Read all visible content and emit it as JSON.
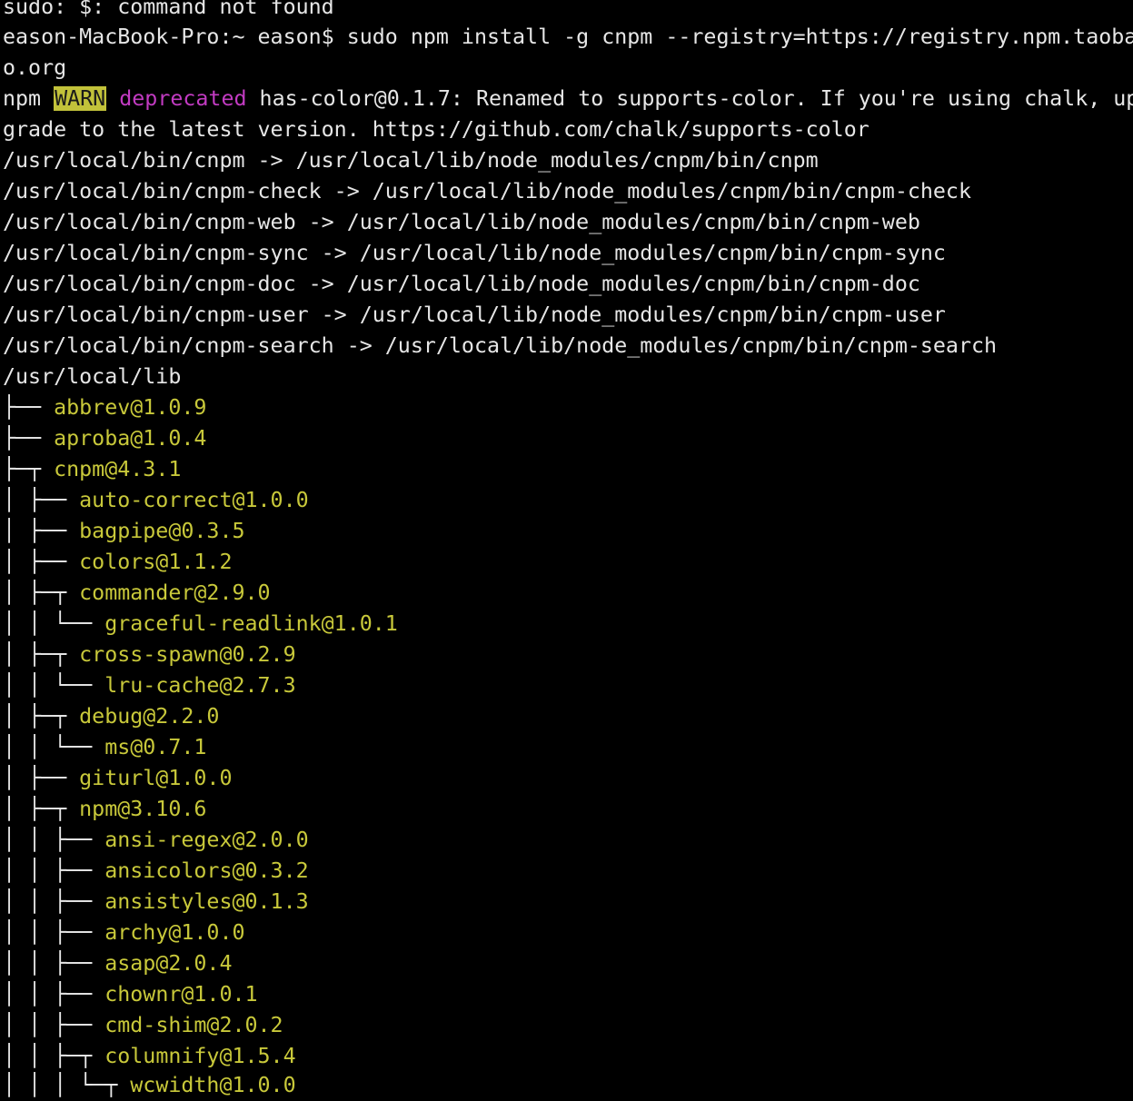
{
  "colors": {
    "background": "#000000",
    "text": "#e6e6e6",
    "package": "#c8c83a",
    "warn_bg": "#c2c23a",
    "deprecated": "#c23bc2"
  },
  "lines": {
    "l0": "sudo: $: command not found",
    "l1": "eason-MacBook-Pro:~ eason$ sudo npm install -g cnpm --registry=https://registry.npm.taoba",
    "l2": "o.org",
    "l3": {
      "prefix": "npm ",
      "warn": "WARN",
      "deprecated": "deprecated",
      "message": " has-color@0.1.7: Renamed to supports-color. If you're using chalk, up"
    },
    "l4": "grade to the latest version. https://github.com/chalk/supports-color",
    "l5": "/usr/local/bin/cnpm -> /usr/local/lib/node_modules/cnpm/bin/cnpm",
    "l6": "/usr/local/bin/cnpm-check -> /usr/local/lib/node_modules/cnpm/bin/cnpm-check",
    "l7": "/usr/local/bin/cnpm-web -> /usr/local/lib/node_modules/cnpm/bin/cnpm-web",
    "l8": "/usr/local/bin/cnpm-sync -> /usr/local/lib/node_modules/cnpm/bin/cnpm-sync",
    "l9": "/usr/local/bin/cnpm-doc -> /usr/local/lib/node_modules/cnpm/bin/cnpm-doc",
    "l10": "/usr/local/bin/cnpm-user -> /usr/local/lib/node_modules/cnpm/bin/cnpm-user",
    "l11": "/usr/local/bin/cnpm-search -> /usr/local/lib/node_modules/cnpm/bin/cnpm-search",
    "l12": "/usr/local/lib"
  },
  "tree": [
    {
      "glyphs": "├── ",
      "pkg": "abbrev@1.0.9"
    },
    {
      "glyphs": "├── ",
      "pkg": "aproba@1.0.4"
    },
    {
      "glyphs": "├─┬ ",
      "pkg": "cnpm@4.3.1"
    },
    {
      "glyphs": "│ ├── ",
      "pkg": "auto-correct@1.0.0"
    },
    {
      "glyphs": "│ ├── ",
      "pkg": "bagpipe@0.3.5"
    },
    {
      "glyphs": "│ ├── ",
      "pkg": "colors@1.1.2"
    },
    {
      "glyphs": "│ ├─┬ ",
      "pkg": "commander@2.9.0"
    },
    {
      "glyphs": "│ │ └── ",
      "pkg": "graceful-readlink@1.0.1"
    },
    {
      "glyphs": "│ ├─┬ ",
      "pkg": "cross-spawn@0.2.9"
    },
    {
      "glyphs": "│ │ └── ",
      "pkg": "lru-cache@2.7.3"
    },
    {
      "glyphs": "│ ├─┬ ",
      "pkg": "debug@2.2.0"
    },
    {
      "glyphs": "│ │ └── ",
      "pkg": "ms@0.7.1"
    },
    {
      "glyphs": "│ ├── ",
      "pkg": "giturl@1.0.0"
    },
    {
      "glyphs": "│ ├─┬ ",
      "pkg": "npm@3.10.6"
    },
    {
      "glyphs": "│ │ ├── ",
      "pkg": "ansi-regex@2.0.0"
    },
    {
      "glyphs": "│ │ ├── ",
      "pkg": "ansicolors@0.3.2"
    },
    {
      "glyphs": "│ │ ├── ",
      "pkg": "ansistyles@0.1.3"
    },
    {
      "glyphs": "│ │ ├── ",
      "pkg": "archy@1.0.0"
    },
    {
      "glyphs": "│ │ ├── ",
      "pkg": "asap@2.0.4"
    },
    {
      "glyphs": "│ │ ├── ",
      "pkg": "chownr@1.0.1"
    },
    {
      "glyphs": "│ │ ├── ",
      "pkg": "cmd-shim@2.0.2"
    },
    {
      "glyphs": "│ │ ├─┬ ",
      "pkg": "columnify@1.5.4"
    },
    {
      "glyphs": "│ │ │ └─┬ ",
      "pkg": "wcwidth@1.0.0"
    }
  ]
}
